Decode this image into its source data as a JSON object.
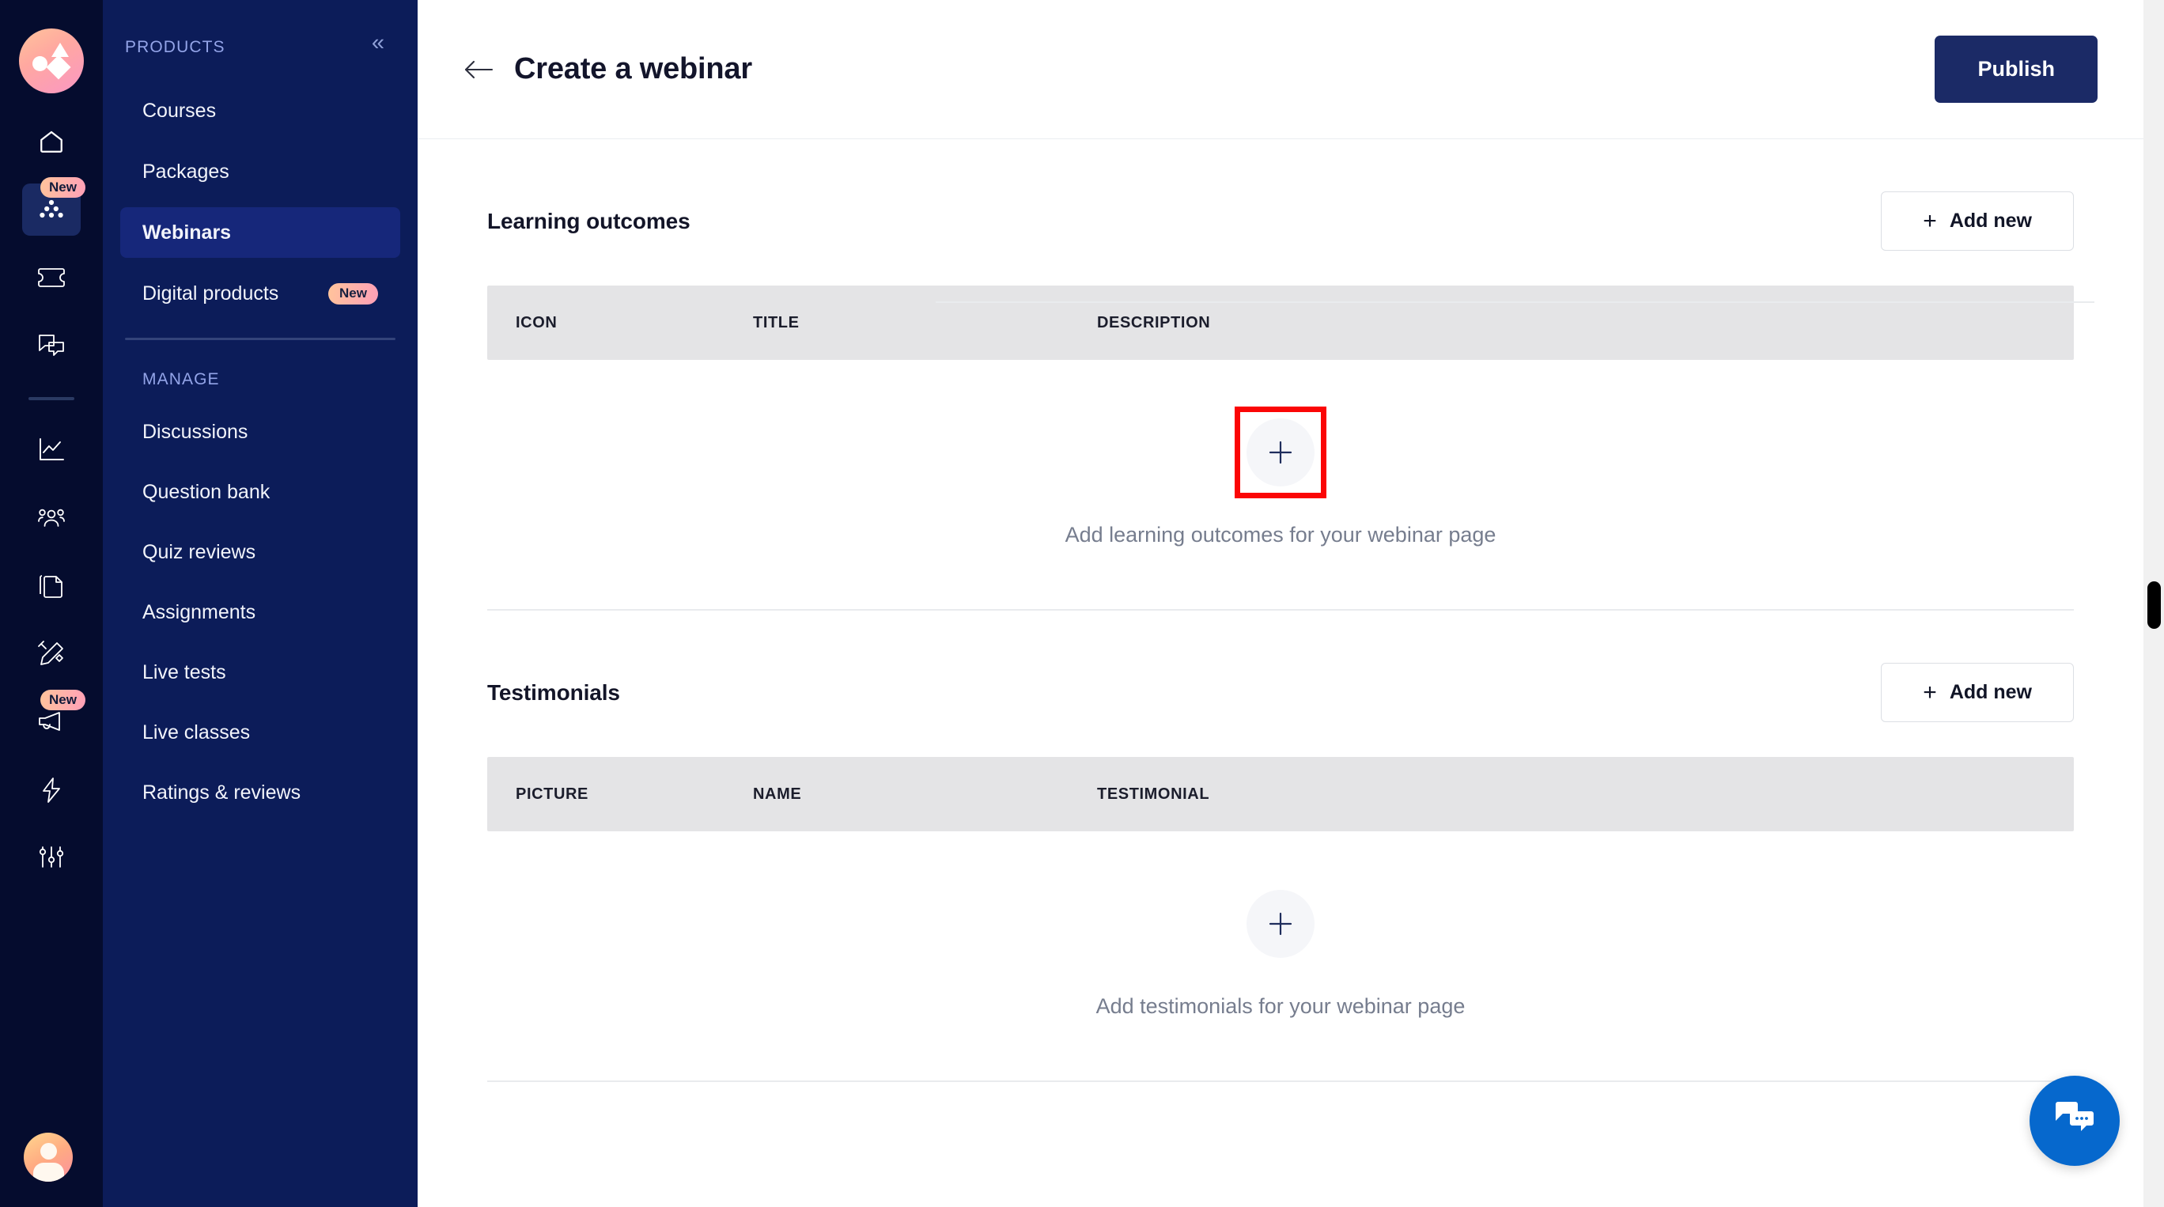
{
  "brand": {
    "logo_name": "app-logo"
  },
  "icon_rail": {
    "items": [
      {
        "name": "home-icon",
        "badge": null
      },
      {
        "name": "products-icon",
        "badge": "New",
        "active": true
      },
      {
        "name": "ticket-icon",
        "badge": null
      },
      {
        "name": "chat-icon",
        "badge": null
      },
      {
        "name": "analytics-icon",
        "badge": null
      },
      {
        "name": "learners-icon",
        "badge": null
      },
      {
        "name": "pages-icon",
        "badge": null
      },
      {
        "name": "design-icon",
        "badge": null
      },
      {
        "name": "marketing-icon",
        "badge": "New"
      },
      {
        "name": "automation-icon",
        "badge": null
      },
      {
        "name": "settings-icon",
        "badge": null
      }
    ],
    "avatar_name": "user-avatar"
  },
  "sidebar": {
    "products_label": "PRODUCTS",
    "collapse_label": "«",
    "products": [
      {
        "label": "Courses",
        "badge": null,
        "active": false
      },
      {
        "label": "Packages",
        "badge": null,
        "active": false
      },
      {
        "label": "Webinars",
        "badge": null,
        "active": true
      },
      {
        "label": "Digital products",
        "badge": "New",
        "active": false
      }
    ],
    "manage_label": "MANAGE",
    "manage": [
      {
        "label": "Discussions",
        "badge": null,
        "active": false
      },
      {
        "label": "Question bank",
        "badge": null,
        "active": false
      },
      {
        "label": "Quiz reviews",
        "badge": null,
        "active": false
      },
      {
        "label": "Assignments",
        "badge": null,
        "active": false
      },
      {
        "label": "Live tests",
        "badge": null,
        "active": false
      },
      {
        "label": "Live classes",
        "badge": null,
        "active": false
      },
      {
        "label": "Ratings & reviews",
        "badge": null,
        "active": false
      }
    ]
  },
  "topbar": {
    "back_label": "back-arrow",
    "title": "Create a webinar",
    "publish_label": "Publish"
  },
  "sections": [
    {
      "title": "Learning outcomes",
      "add_label": "Add new",
      "add_plus": "+",
      "columns": [
        "ICON",
        "TITLE",
        "DESCRIPTION"
      ],
      "empty_text": "Add learning outcomes for your webinar page",
      "highlighted": true
    },
    {
      "title": "Testimonials",
      "add_label": "Add new",
      "add_plus": "+",
      "columns": [
        "PICTURE",
        "NAME",
        "TESTIMONIAL"
      ],
      "empty_text": "Add testimonials for your webinar page",
      "highlighted": false
    }
  ],
  "chat": {
    "name": "chat-support-button"
  },
  "colors": {
    "rail_bg": "#050c2e",
    "sidebar_bg": "#0c1c59",
    "sidebar_active": "#16277a",
    "accent_navy": "#1b2a66",
    "badge_gradient_start": "#ffc49b",
    "badge_gradient_end": "#ff9fb8",
    "table_head_bg": "#e4e4e6",
    "highlight_red": "#fb0606",
    "chat_blue": "#0668cd",
    "muted_text": "#767d8e"
  }
}
